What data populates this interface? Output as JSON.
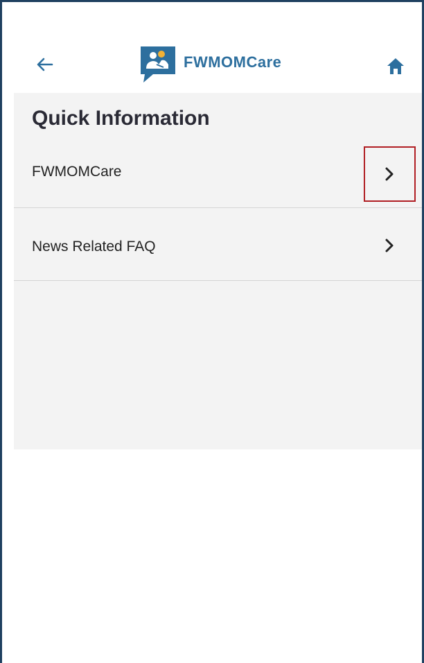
{
  "header": {
    "app_name": "FWMOMCare",
    "back_icon": "arrow-left-icon",
    "home_icon": "home-icon",
    "logo_icon": "chat-people-logo-icon",
    "brand_color": "#2d6f9e"
  },
  "main": {
    "title": "Quick Information",
    "items": [
      {
        "label": "FWMOMCare",
        "icon": "chevron-right-icon"
      },
      {
        "label": "News Related FAQ",
        "icon": "chevron-right-icon"
      }
    ]
  },
  "colors": {
    "frame_border": "#1f4060",
    "content_background": "#f3f3f3",
    "highlight": "#b01e23"
  }
}
